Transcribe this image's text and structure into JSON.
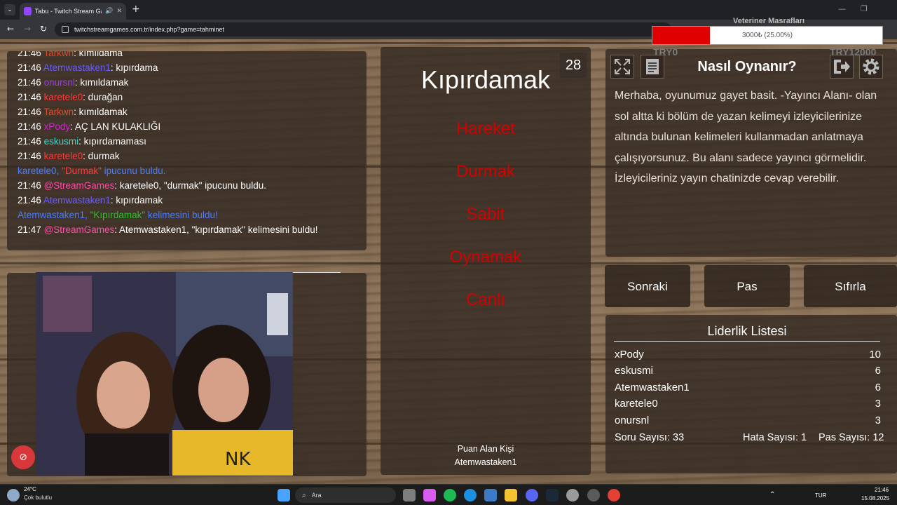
{
  "browser": {
    "tab_title": "Tabu - Twitch Stream Game",
    "url": "twitchstreamgames.com.tr/index.php?game=tahminet"
  },
  "overlay": {
    "title": "Veteriner Masrafları",
    "progress_text": "3000₺ (25.00%)",
    "progress_fraction": 0.25,
    "min_label": "TRY0",
    "max_label": "TRY12000"
  },
  "chat": [
    {
      "time": "21:46",
      "user": "Tarkwn",
      "user_color": "#e04a2a",
      "msg": ": kımıldama"
    },
    {
      "time": "21:46",
      "user": "Atemwastaken1",
      "user_color": "#6a5cff",
      "msg": ": kıpırdama"
    },
    {
      "time": "21:46",
      "user": "onursnl",
      "user_color": "#9b3ce0",
      "msg": ": kımıldamak"
    },
    {
      "time": "21:46",
      "user": "karetele0",
      "user_color": "#ff3b3b",
      "msg": ": durağan"
    },
    {
      "time": "21:46",
      "user": "Tarkwn",
      "user_color": "#e04a2a",
      "msg": ": kımıldamak"
    },
    {
      "time": "21:46",
      "user": "xPody",
      "user_color": "#d623d6",
      "msg": ": AÇ LAN KULAKLIĞI"
    },
    {
      "time": "21:46",
      "user": "eskusmi",
      "user_color": "#3cd6c8",
      "msg": ": kıpırdamaması"
    },
    {
      "time": "21:46",
      "user": "karetele0",
      "user_color": "#ff3b3b",
      "msg": ": durmak"
    }
  ],
  "chat_notice_1": {
    "pre": "karetele0, ",
    "word": "\"Durmak\"",
    "post": " ipucunu buldu."
  },
  "chat_system_1": {
    "time": "21:46",
    "user": "@StreamGames",
    "msg": ": karetele0, \"durmak\" ipucunu buldu."
  },
  "chat_line_10": {
    "time": "21:46",
    "user": "Atemwastaken1",
    "msg": ": kıpırdamak"
  },
  "chat_notice_2": {
    "pre": "Atemwastaken1, ",
    "word": "\"Kıpırdamak\"",
    "post": " kelimesini buldu!"
  },
  "chat_system_2": {
    "time": "21:47",
    "user": "@StreamGames",
    "msg": ": Atemwastaken1, \"kıpırdamak\" kelimesini buldu!"
  },
  "game": {
    "timer": "28",
    "word": "Kıpırdamak",
    "taboo": [
      "Hareket",
      "Durmak",
      "Sabit",
      "Oynamak",
      "Canlı"
    ],
    "scorer_label": "Puan Alan Kişi",
    "scorer": "Atemwastaken1"
  },
  "how_to": {
    "title": "Nasıl Oynanır?",
    "text": "Merhaba, oyunumuz gayet basit. -Yayıncı Alanı- olan sol altta ki bölüm de yazan kelimeyi izleyicilerinize altında bulunan kelimeleri kullanmadan anlatmaya çalışıyorsunuz. Bu alanı sadece yayıncı görmelidir. İzleyicileriniz yayın chatinizde cevap verebilir.",
    "icons": [
      "fullscreen-icon",
      "notes-icon",
      "logout-icon",
      "settings-gear-icon"
    ]
  },
  "buttons": {
    "next": "Sonraki",
    "pass": "Pas",
    "reset": "Sıfırla"
  },
  "leaderboard": {
    "title": "Liderlik Listesi",
    "rows": [
      {
        "name": "xPody",
        "score": "10"
      },
      {
        "name": "eskusmi",
        "score": "6"
      },
      {
        "name": "Atemwastaken1",
        "score": "6"
      },
      {
        "name": "karetele0",
        "score": "3"
      },
      {
        "name": "onursnl",
        "score": "3"
      }
    ],
    "questions": "Soru Sayısı: 33",
    "errors": "Hata Sayısı: 1",
    "passes": "Pas Sayısı: 12"
  },
  "taskbar": {
    "temp": "24°C",
    "weather": "Çok bulutlu",
    "search_placeholder": "Ara",
    "lang": "TUR",
    "time": "21:46",
    "date": "15.08.2025"
  }
}
